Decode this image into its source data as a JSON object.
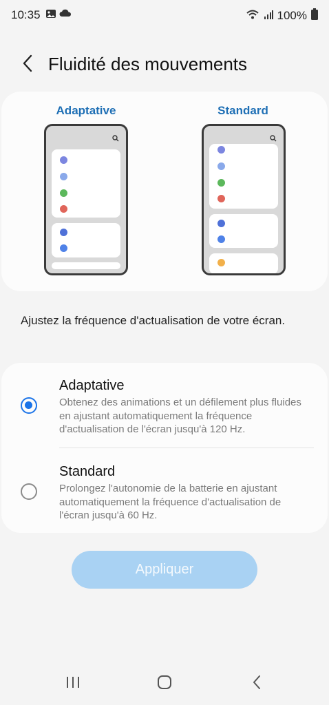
{
  "status_bar": {
    "time": "10:35",
    "battery": "100%"
  },
  "header": {
    "title": "Fluidité des mouvements"
  },
  "preview": {
    "adaptive_label": "Adaptative",
    "standard_label": "Standard"
  },
  "description": "Ajustez la fréquence d'actualisation de votre écran.",
  "options": [
    {
      "title": "Adaptative",
      "subtitle": "Obtenez des animations et un défilement plus fluides en ajustant automatiquement la fréquence d'actualisation de l'écran jusqu'à 120 Hz.",
      "selected": true
    },
    {
      "title": "Standard",
      "subtitle": "Prolongez l'autonomie de la batterie en ajustant automatiquement la fréquence d'actualisation de l'écran jusqu'à 60 Hz.",
      "selected": false
    }
  ],
  "apply_button": {
    "label": "Appliquer",
    "enabled": false
  },
  "colors": {
    "accent": "#1a73e8",
    "label_blue": "#1e6fb5",
    "button_disabled": "#a9d2f3"
  },
  "icons": [
    "gallery-icon",
    "cloud-icon",
    "wifi-icon",
    "signal-icon",
    "battery-icon",
    "back-arrow-icon",
    "search-icon",
    "recents-icon",
    "home-icon",
    "nav-back-icon"
  ]
}
